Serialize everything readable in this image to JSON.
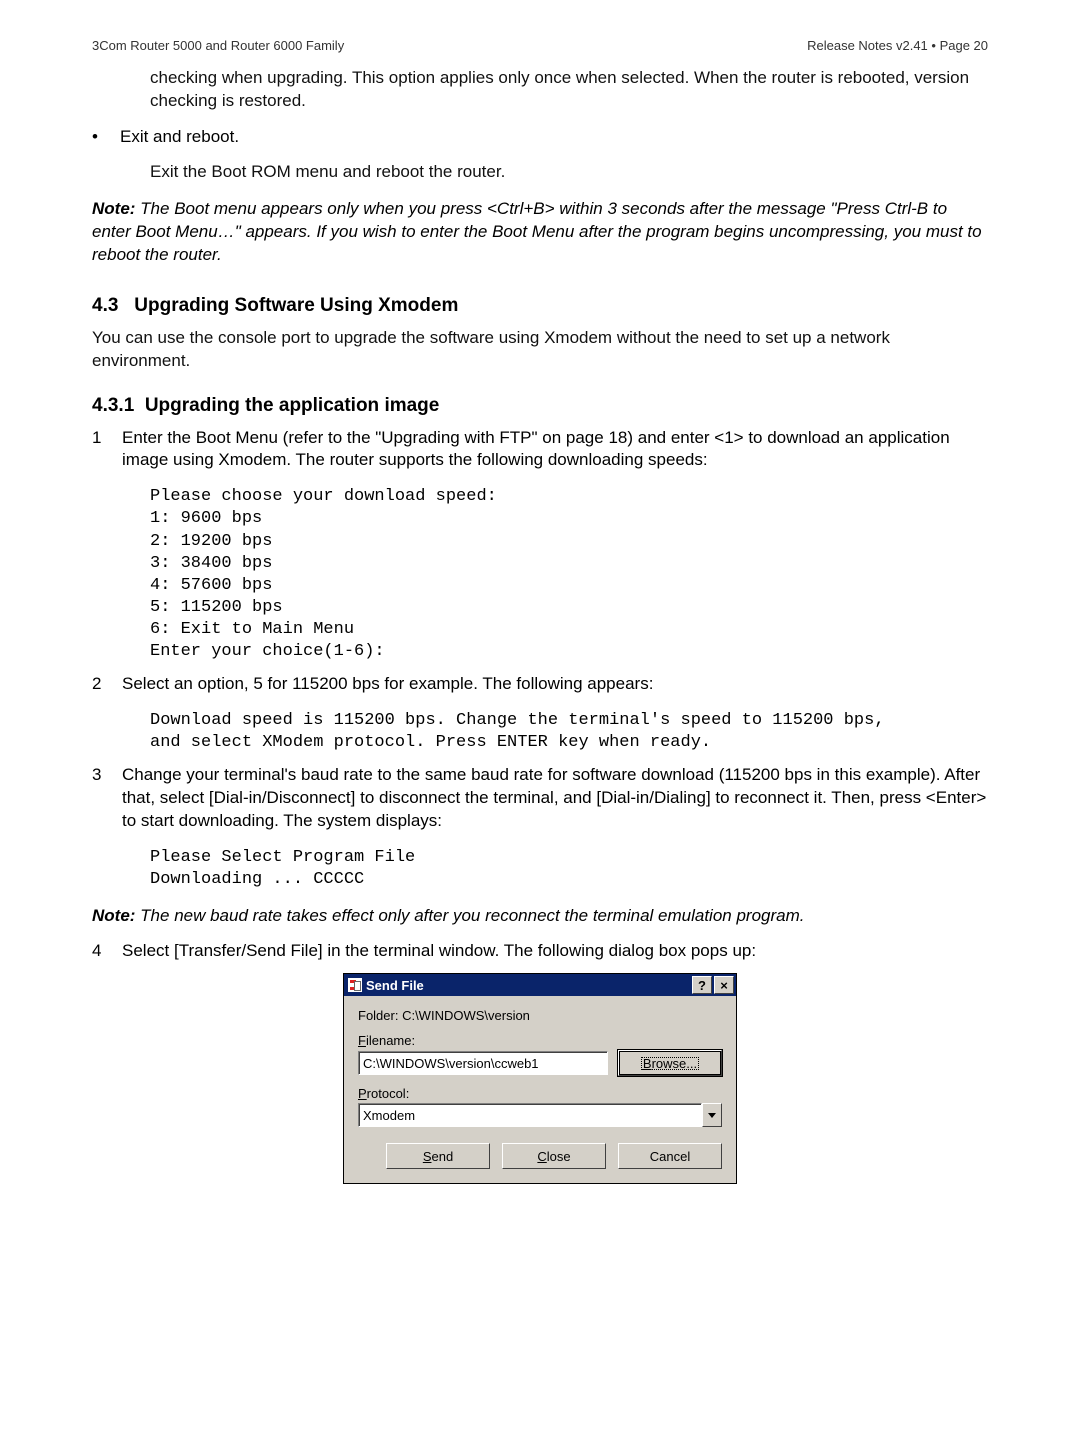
{
  "header": {
    "left": "3Com Router 5000 and Router 6000 Family",
    "right": "Release Notes v2.41 • Page 20"
  },
  "intro_indent": "checking when upgrading. This option applies only once when selected. When the router is rebooted, version checking is restored.",
  "bullet1": "Exit and reboot.",
  "bullet1_body": "Exit the Boot ROM menu and reboot the router.",
  "note1_label": "Note:",
  "note1_body": " The Boot menu appears only when you press <Ctrl+B> within 3 seconds after the message \"Press Ctrl-B to enter Boot Menu…\" appears. If you wish to enter the Boot Menu after the program begins uncompressing, you must to reboot the router.",
  "sec43_num": "4.3",
  "sec43_title": "Upgrading Software Using Xmodem",
  "sec43_body": "You can use the console port to upgrade the software using Xmodem without the need to set up a network environment.",
  "sec431_num": "4.3.1",
  "sec431_title": "Upgrading the application image",
  "step1": "Enter the Boot Menu (refer to the \"Upgrading with FTP\" on page 18) and enter <1> to download an application image using Xmodem. The router supports the following downloading speeds:",
  "code1": "Please choose your download speed:\n1: 9600 bps\n2: 19200 bps\n3: 38400 bps\n4: 57600 bps\n5: 115200 bps\n6: Exit to Main Menu\nEnter your choice(1-6):",
  "step2": "Select an option, 5 for 115200 bps for example. The following appears:",
  "code2": "Download speed is 115200 bps. Change the terminal's speed to 115200 bps,\nand select XModem protocol. Press ENTER key when ready.",
  "step3": "Change your terminal's baud rate to the same baud rate for software download (115200 bps in this example). After that, select [Dial-in/Disconnect] to disconnect the terminal, and [Dial-in/Dialing] to reconnect it. Then, press <Enter> to start downloading. The system displays:",
  "code3": "Please Select Program File\nDownloading ... CCCCC",
  "note2_label": "Note:",
  "note2_body": " The new baud rate takes effect only after you reconnect the terminal emulation program.",
  "step4": "Select [Transfer/Send File] in the terminal window. The following dialog box pops up:",
  "dialog": {
    "title": "Send File",
    "folder_label": "Folder: C:\\WINDOWS\\version",
    "filename_label_first": "F",
    "filename_label_rest": "ilename:",
    "filename_value": "C:\\WINDOWS\\version\\ccweb1",
    "browse_first": "B",
    "browse_rest": "rowse...",
    "protocol_label_first": "P",
    "protocol_label_rest": "rotocol:",
    "protocol_value": "Xmodem",
    "send_first": "S",
    "send_rest": "end",
    "close_first": "C",
    "close_rest": "lose",
    "cancel": "Cancel",
    "help_glyph": "?",
    "close_glyph": "×"
  }
}
